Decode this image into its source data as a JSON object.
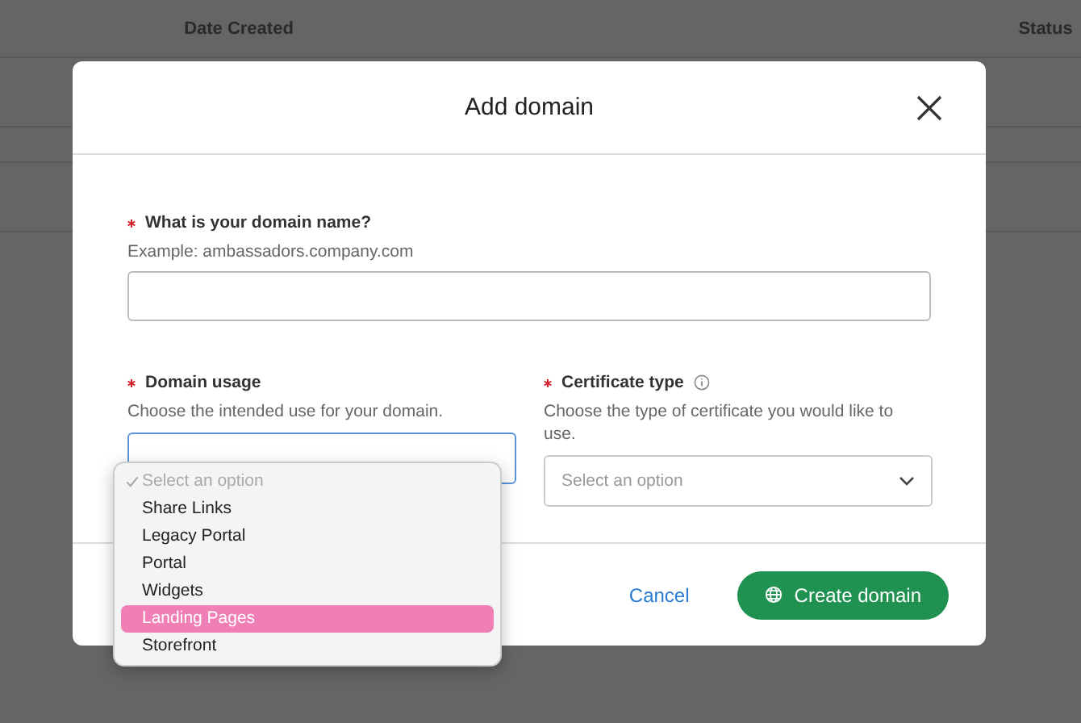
{
  "background_table": {
    "columns": [
      "Date Created",
      "Status"
    ]
  },
  "dialog": {
    "title": "Add domain",
    "domain_name": {
      "label": "What is your domain name?",
      "required": true,
      "hint": "Example: ambassadors.company.com"
    },
    "domain_usage": {
      "label": "Domain usage",
      "required": true,
      "hint": "Choose the intended use for your domain.",
      "expanded": true,
      "options": [
        {
          "label": "Select an option",
          "checked": true,
          "disabled": true,
          "selected": false
        },
        {
          "label": "Share Links",
          "checked": false,
          "disabled": false,
          "selected": false
        },
        {
          "label": "Legacy Portal",
          "checked": false,
          "disabled": false,
          "selected": false
        },
        {
          "label": "Portal",
          "checked": false,
          "disabled": false,
          "selected": false
        },
        {
          "label": "Widgets",
          "checked": false,
          "disabled": false,
          "selected": false
        },
        {
          "label": "Landing Pages",
          "checked": false,
          "disabled": false,
          "selected": true
        },
        {
          "label": "Storefront",
          "checked": false,
          "disabled": false,
          "selected": false
        }
      ]
    },
    "certificate_type": {
      "label": "Certificate type",
      "required": true,
      "hint": "Choose the type of certificate you would like to use.",
      "placeholder": "Select an option"
    },
    "buttons": [
      {
        "kind": "link",
        "label": "Cancel"
      },
      {
        "kind": "primary",
        "label": "Create domain"
      }
    ]
  }
}
